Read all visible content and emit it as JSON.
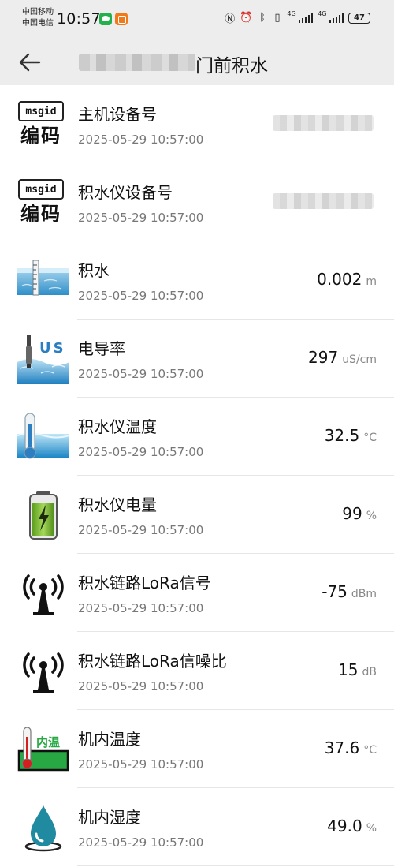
{
  "status_bar": {
    "carrier_1": "中国移动",
    "carrier_2": "中国电信",
    "time": "10:57",
    "network_1": "4G",
    "network_2": "4G",
    "battery": "47"
  },
  "header": {
    "title_visible": "门前积水"
  },
  "items": [
    {
      "name": "主机设备号",
      "time": "2025-05-29 10:57:00",
      "value": "",
      "unit": "",
      "icon": "msgid-code-icon",
      "code_label": "msgid",
      "code_cn": "编码"
    },
    {
      "name": "积水仪设备号",
      "time": "2025-05-29 10:57:00",
      "value": "",
      "unit": "",
      "icon": "msgid-code-icon",
      "code_label": "msgid",
      "code_cn": "编码"
    },
    {
      "name": "积水",
      "time": "2025-05-29 10:57:00",
      "value": "0.002",
      "unit": "m",
      "icon": "water-level-icon"
    },
    {
      "name": "电导率",
      "time": "2025-05-29 10:57:00",
      "value": "297",
      "unit": "uS/cm",
      "icon": "conductivity-icon",
      "icon_text": "US"
    },
    {
      "name": "积水仪温度",
      "time": "2025-05-29 10:57:00",
      "value": "32.5",
      "unit": "°C",
      "icon": "water-thermometer-icon"
    },
    {
      "name": "积水仪电量",
      "time": "2025-05-29 10:57:00",
      "value": "99",
      "unit": "%",
      "icon": "battery-charge-icon"
    },
    {
      "name": "积水链路LoRa信号",
      "time": "2025-05-29 10:57:00",
      "value": "-75",
      "unit": "dBm",
      "icon": "antenna-icon"
    },
    {
      "name": "积水链路LoRa信噪比",
      "time": "2025-05-29 10:57:00",
      "value": "15",
      "unit": "dB",
      "icon": "antenna-icon"
    },
    {
      "name": "机内温度",
      "time": "2025-05-29 10:57:00",
      "value": "37.6",
      "unit": "°C",
      "icon": "internal-temp-icon",
      "icon_text": "内温"
    },
    {
      "name": "机内湿度",
      "time": "2025-05-29 10:57:00",
      "value": "49.0",
      "unit": "%",
      "icon": "water-drop-icon"
    }
  ]
}
